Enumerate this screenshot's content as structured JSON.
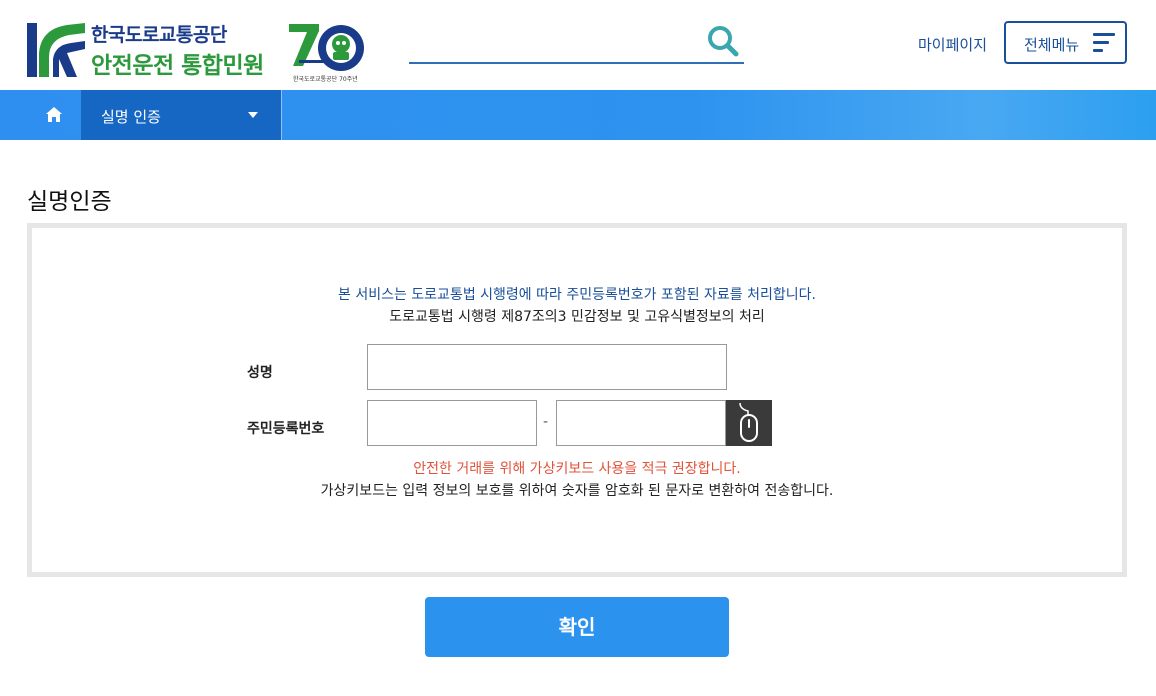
{
  "header": {
    "logo_line1": "한국도로교통공단",
    "logo_line2": "안전운전 통합민원",
    "anniversary_caption": "한국도로교통공단 70주년",
    "search": {
      "value": "",
      "placeholder": ""
    },
    "mypage_label": "마이페이지",
    "allmenu_label": "전체메뉴"
  },
  "nav": {
    "home_icon": "home-icon",
    "dropdown_label": "실명 인증"
  },
  "page": {
    "title": "실명인증",
    "notice_line1": "본 서비스는 도로교통법 시행령에 따라 주민등록번호가 포함된 자료를 처리합니다.",
    "notice_line2": "도로교통법 시행령 제87조의3 민감정보 및 고유식별정보의 처리",
    "form": {
      "name_label": "성명",
      "name_value": "",
      "rrn_label": "주민등록번호",
      "rrn_front_value": "",
      "rrn_separator": "-",
      "rrn_back_value": "",
      "virtual_keyboard_icon": "mouse-icon"
    },
    "warning_line1": "안전한 거래를 위해 가상키보드 사용을 적극 권장합니다.",
    "warning_line2": "가상키보드는 입력 정보의 보호를 위하여 숫자를 암호화 된 문자로 변환하여 전송합니다.",
    "confirm_label": "확인"
  },
  "colors": {
    "brand_navy": "#1a4f9a",
    "brand_green": "#2c9a3c",
    "nav_blue": "#2f8ff0",
    "nav_dark": "#1667c4",
    "warning_red": "#e0533a",
    "button_blue": "#2b93ee"
  }
}
